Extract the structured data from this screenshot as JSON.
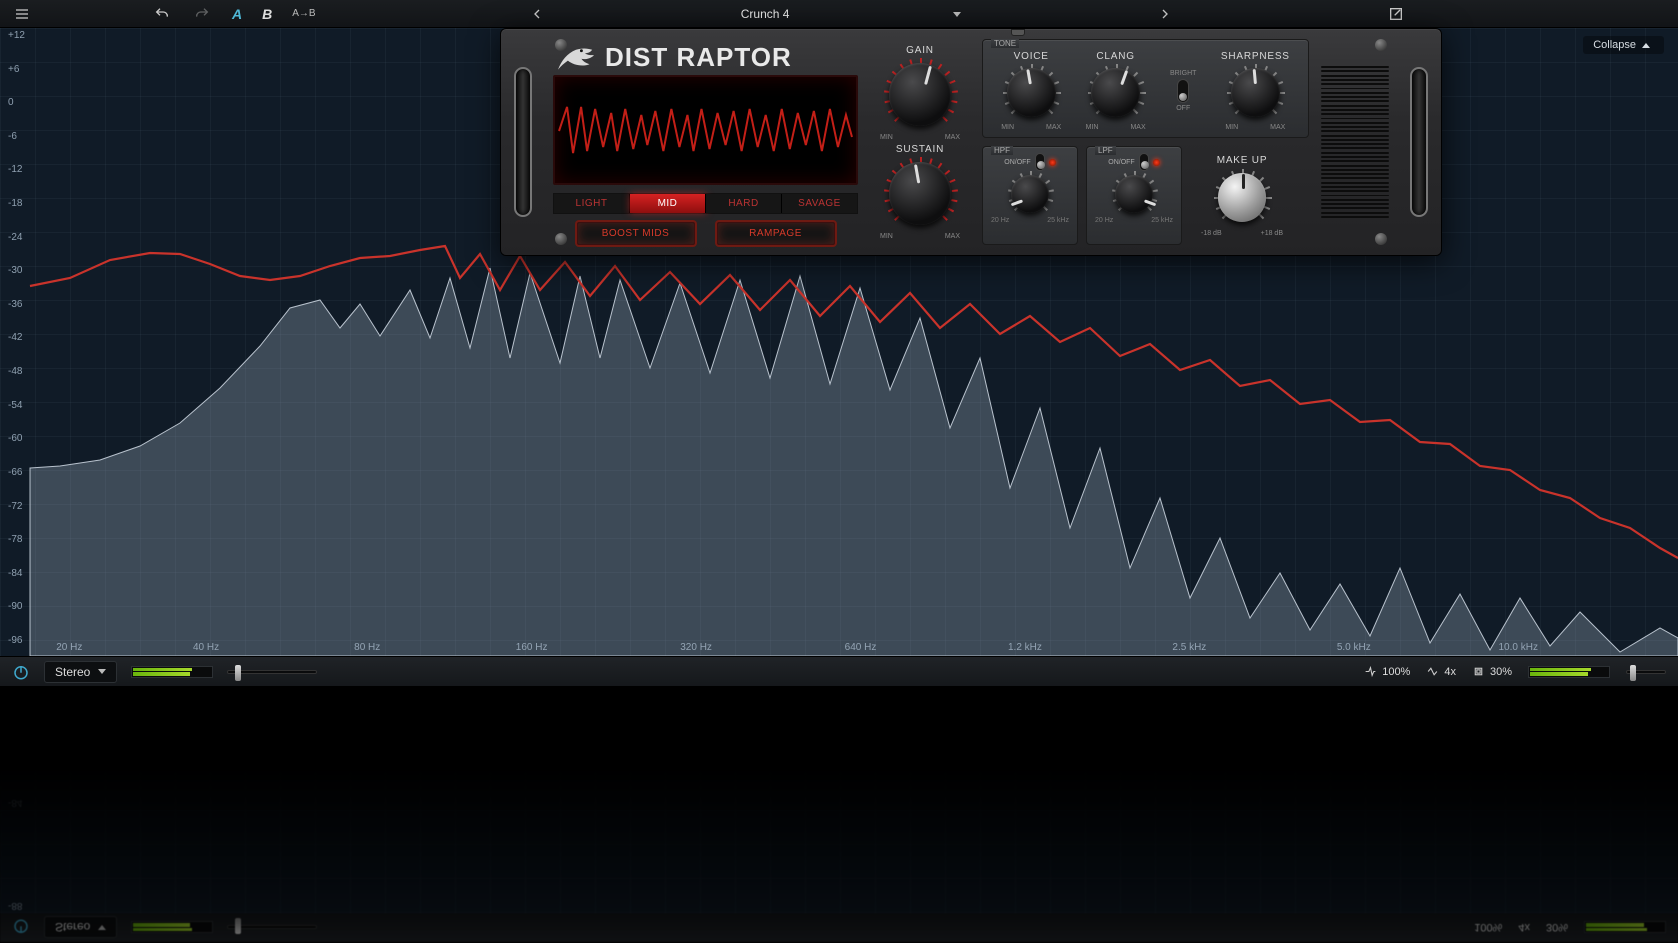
{
  "toolbar": {
    "preset_name": "Crunch 4",
    "compare_a": "A",
    "compare_b": "B",
    "copy_ab": "A→B"
  },
  "analyzer": {
    "collapse_label": "Collapse",
    "db_labels": [
      "+12",
      "+6",
      "0",
      "-6",
      "-12",
      "-18",
      "-24",
      "-30",
      "-36",
      "-42",
      "-48",
      "-54",
      "-60",
      "-66",
      "-72",
      "-78",
      "-84",
      "-90",
      "-96"
    ],
    "hz_labels": [
      {
        "t": "20 Hz",
        "p": 1.8
      },
      {
        "t": "40 Hz",
        "p": 10.2
      },
      {
        "t": "80 Hz",
        "p": 20.1
      },
      {
        "t": "160 Hz",
        "p": 30.2
      },
      {
        "t": "320 Hz",
        "p": 40.3
      },
      {
        "t": "640 Hz",
        "p": 50.4
      },
      {
        "t": "1.2 kHz",
        "p": 60.5
      },
      {
        "t": "2.5 kHz",
        "p": 70.6
      },
      {
        "t": "5.0 kHz",
        "p": 80.7
      },
      {
        "t": "10.0 kHz",
        "p": 90.8
      }
    ]
  },
  "plugin": {
    "title": "DIST RAPTOR",
    "modes": [
      "LIGHT",
      "MID",
      "HARD",
      "SAVAGE"
    ],
    "mode_active": 1,
    "boost_mids": "BOOST MIDS",
    "rampage": "RAMPAGE",
    "gain_label": "GAIN",
    "sustain_label": "SUSTAIN",
    "min": "MIN",
    "max": "MAX",
    "tone_title": "TONE",
    "voice": "VOICE",
    "clang": "CLANG",
    "sharpness": "SHARPNESS",
    "bright": "BRIGHT",
    "bright_off": "OFF",
    "hpf": "HPF",
    "lpf": "LPF",
    "onoff": "ON/OFF",
    "hpf_lo": "20 Hz",
    "hpf_hi": "25 kHz",
    "lpf_lo": "20 Hz",
    "lpf_hi": "25 kHz",
    "makeup": "MAKE UP",
    "makeup_lo": "-18 dB",
    "makeup_hi": "+18 dB"
  },
  "bottom": {
    "channel_mode": "Stereo",
    "mix_pct": "100%",
    "oversample": "4x",
    "cpu": "30%"
  }
}
